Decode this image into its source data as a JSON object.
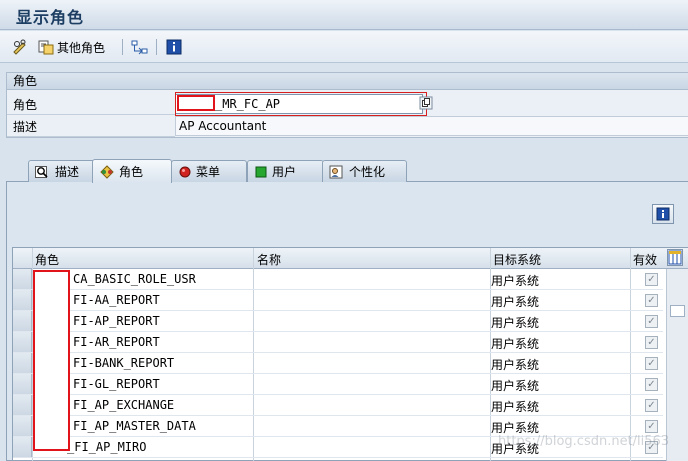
{
  "window": {
    "title": "显示角色"
  },
  "toolbar": {
    "other_role_label": "其他角色"
  },
  "header_group": {
    "title": "角色",
    "role_label": "角色",
    "role_value": "_MR_FC_AP",
    "desc_label": "描述",
    "desc_value": "AP Accountant"
  },
  "tabs": [
    {
      "label": "描述",
      "icon": "magnifier-icon"
    },
    {
      "label": "角色",
      "icon": "roles-icon"
    },
    {
      "label": "菜单",
      "icon": "red-dot-icon"
    },
    {
      "label": "用户",
      "icon": "green-square-icon"
    },
    {
      "label": "个性化",
      "icon": "personalize-icon"
    }
  ],
  "table": {
    "headers": {
      "role": "角色",
      "name": "名称",
      "target": "目标系统",
      "valid": "有效"
    },
    "rows": [
      {
        "role": "CA_BASIC_ROLE_USR",
        "name": "",
        "target": "用户系统",
        "valid": true
      },
      {
        "role": "FI-AA_REPORT",
        "name": "",
        "target": "用户系统",
        "valid": true
      },
      {
        "role": "FI-AP_REPORT",
        "name": "",
        "target": "用户系统",
        "valid": true
      },
      {
        "role": "FI-AR_REPORT",
        "name": "",
        "target": "用户系统",
        "valid": true
      },
      {
        "role": "FI-BANK_REPORT",
        "name": "",
        "target": "用户系统",
        "valid": true
      },
      {
        "role": "FI-GL_REPORT",
        "name": "",
        "target": "用户系统",
        "valid": true
      },
      {
        "role": "FI_AP_EXCHANGE",
        "name": "",
        "target": "用户系统",
        "valid": true
      },
      {
        "role": "FI_AP_MASTER_DATA",
        "name": "",
        "target": "用户系统",
        "valid": true
      },
      {
        "role": "_FI_AP_MIRO",
        "name": "",
        "target": "用户系统",
        "valid": true
      }
    ]
  },
  "watermark": "https://blog.csdn.net/li563",
  "colors": {
    "accent": "#1d3e63",
    "mask_border": "#e0141a"
  }
}
